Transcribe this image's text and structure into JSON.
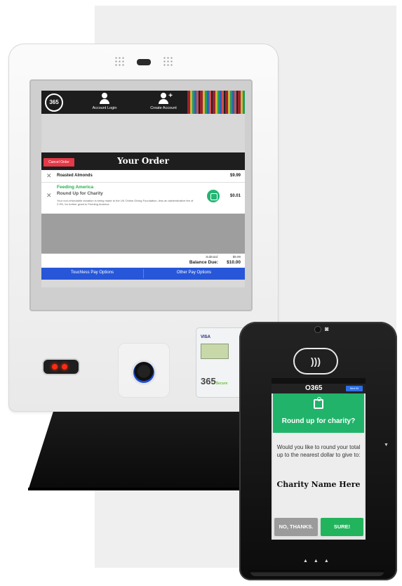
{
  "kiosk": {
    "header": {
      "logo": "365",
      "account_login": "Account Login",
      "create_account": "Create Account"
    },
    "order": {
      "cancel_label": "Cancel Order",
      "title": "Your Order",
      "items": [
        {
          "name": "Roasted Almonds",
          "price": "$9.99"
        }
      ],
      "donation": {
        "org": "Feeding America",
        "label": "Round Up for Charity",
        "fine_print": "Your non-refundable donation is being made to the UK Online Giving Foundation, less an administrative fee of 2.9%, for further grant to Feeding America",
        "price": "$0.01"
      },
      "subtotal_label": "Subtotal:",
      "subtotal_value": "$9.99",
      "balance_label": "Balance Due:",
      "balance_value": "$10.00"
    },
    "payment": {
      "touchless": "Touchless Pay Options",
      "other": "Other Pay Options"
    },
    "reader": {
      "cards": "VISA",
      "brand": "365",
      "brand_sub": "Secure"
    }
  },
  "terminal": {
    "logo": "O365",
    "top_button": "Next Kit",
    "status": "",
    "question": "Round up for charity?",
    "message": "Would you like to round your total up to the nearest dollar to give to:",
    "charity_name": "Charity Name Here",
    "decline": "NO, THANKS.",
    "accept": "SURE!"
  },
  "colors": {
    "accent_green": "#21b36a",
    "pay_blue": "#2757d8",
    "cancel_red": "#e53947"
  },
  "icons": [
    "account-icon",
    "create-account-icon",
    "charity-icon",
    "gift-icon",
    "contactless-icon",
    "camera-icon"
  ]
}
